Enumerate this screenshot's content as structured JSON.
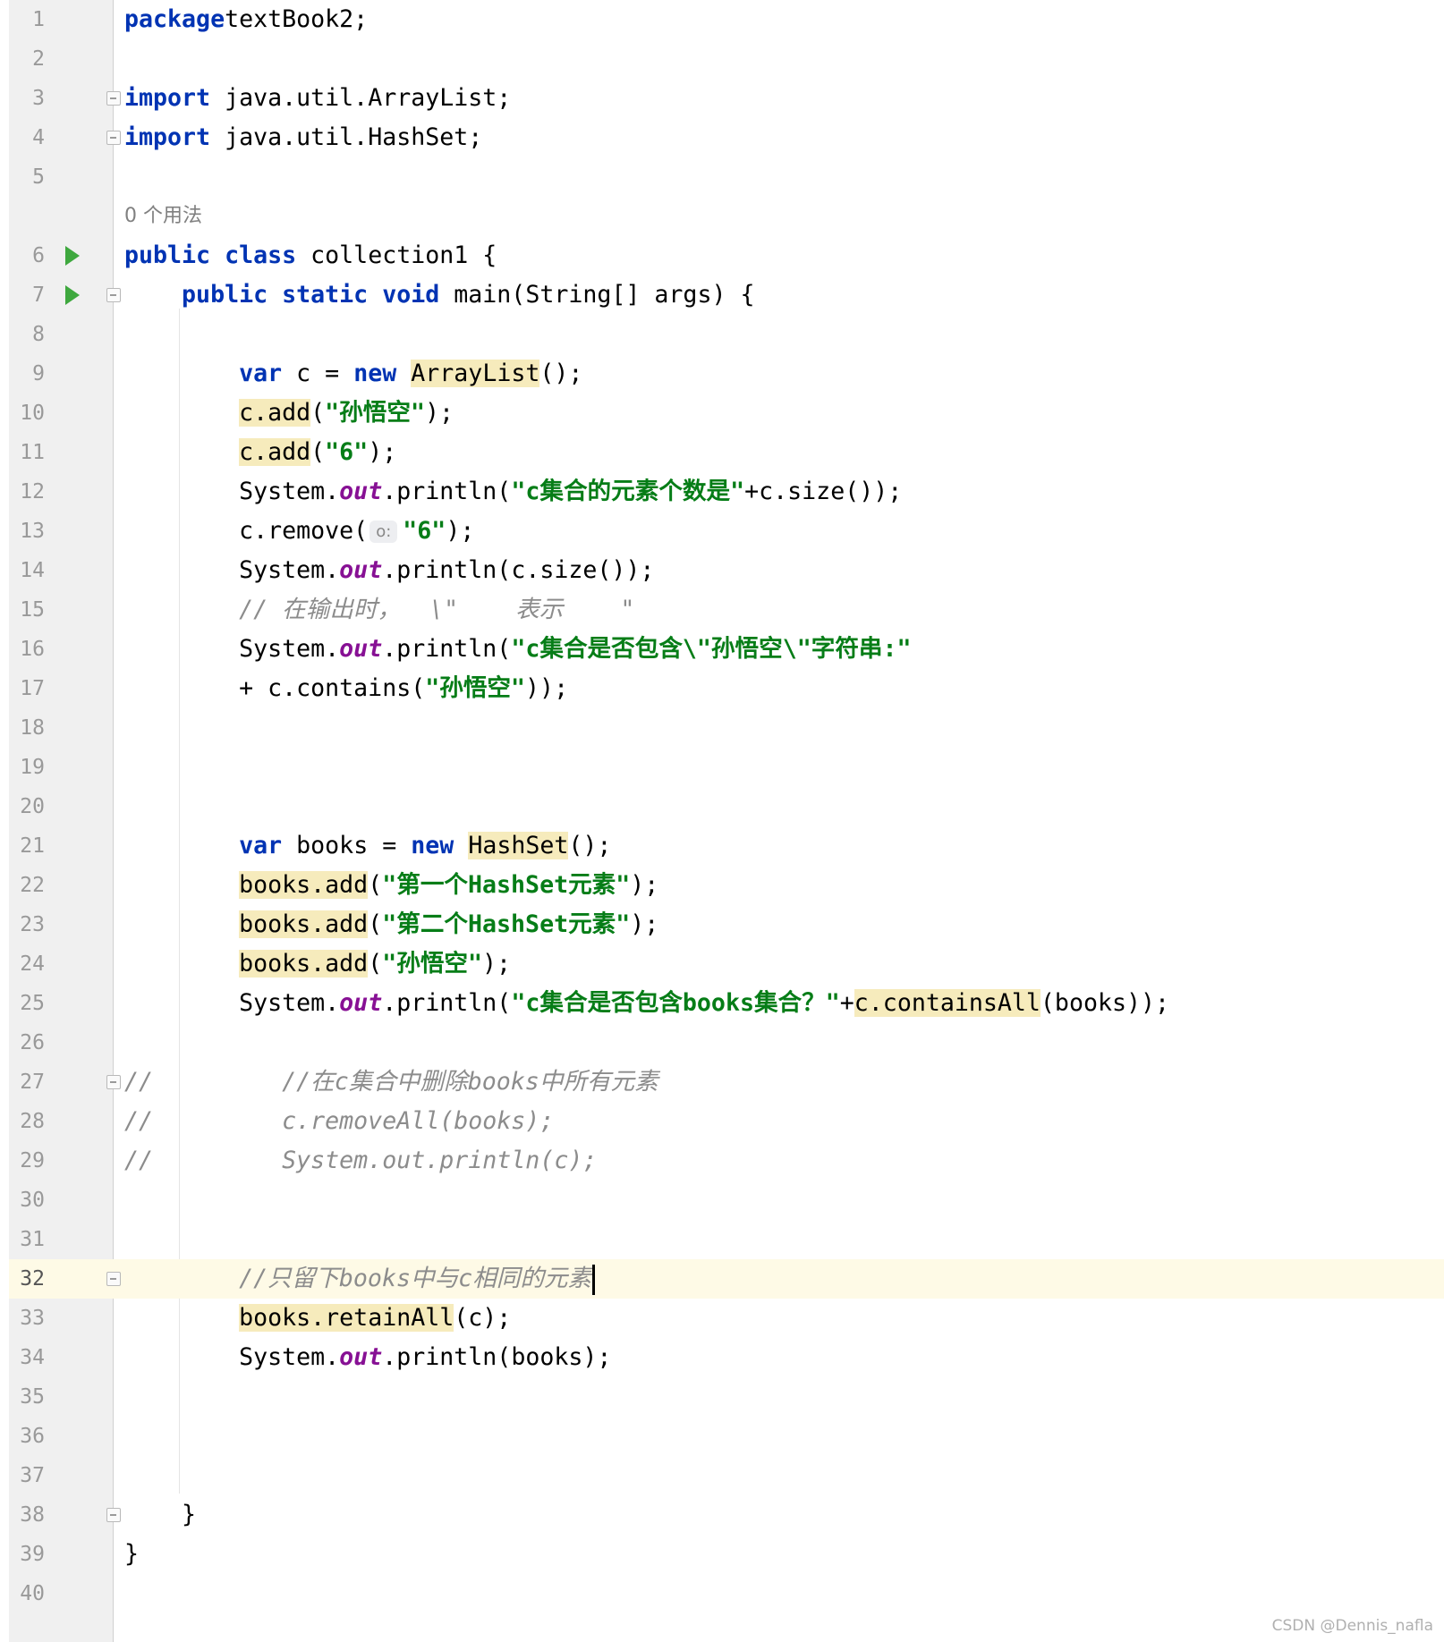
{
  "editor": {
    "usage_hint": "0 个用法",
    "param_hint": "o:",
    "lines": [
      {
        "n": "1",
        "parts": [
          [
            "kw",
            "package"
          ],
          [
            "",
            "textBook2;"
          ]
        ]
      },
      {
        "n": "2",
        "parts": []
      },
      {
        "n": "3",
        "fold": true,
        "parts": [
          [
            "kw",
            "import"
          ],
          [
            "",
            " java.util.ArrayList;"
          ]
        ]
      },
      {
        "n": "4",
        "fold": true,
        "parts": [
          [
            "kw",
            "import"
          ],
          [
            "",
            " java.util.HashSet;"
          ]
        ]
      },
      {
        "n": "5",
        "parts": []
      },
      {
        "n": "6",
        "run": true,
        "parts": [
          [
            "kw",
            "public class"
          ],
          [
            "",
            " collection1 {"
          ]
        ]
      },
      {
        "n": "7",
        "run": true,
        "fold": true,
        "parts": [
          [
            "",
            "    "
          ],
          [
            "kw",
            "public static void"
          ],
          [
            "",
            " main(String[] args) {"
          ]
        ]
      },
      {
        "n": "8",
        "parts": []
      },
      {
        "n": "9",
        "parts": [
          [
            "",
            "        "
          ],
          [
            "kw",
            "var"
          ],
          [
            "",
            " c = "
          ],
          [
            "kw",
            "new"
          ],
          [
            "",
            " "
          ],
          [
            "hl",
            "ArrayList"
          ],
          [
            "",
            "();"
          ]
        ]
      },
      {
        "n": "10",
        "parts": [
          [
            "",
            "        "
          ],
          [
            "hl",
            "c.add"
          ],
          [
            "",
            "("
          ],
          [
            "str",
            "\"孙悟空\""
          ],
          [
            "",
            ");"
          ]
        ]
      },
      {
        "n": "11",
        "parts": [
          [
            "",
            "        "
          ],
          [
            "hl",
            "c.add"
          ],
          [
            "",
            "("
          ],
          [
            "str",
            "\"6\""
          ],
          [
            "",
            ");"
          ]
        ]
      },
      {
        "n": "12",
        "parts": [
          [
            "",
            "        System."
          ],
          [
            "fld",
            "out"
          ],
          [
            "",
            ".println("
          ],
          [
            "str",
            "\"c集合的元素个数是\""
          ],
          [
            "",
            "+c.size());"
          ]
        ]
      },
      {
        "n": "13",
        "parts": [
          [
            "",
            "        c.remove("
          ],
          [
            "hint",
            "o:"
          ],
          [
            "str",
            "\"6\""
          ],
          [
            "",
            ");"
          ]
        ]
      },
      {
        "n": "14",
        "parts": [
          [
            "",
            "        System."
          ],
          [
            "fld",
            "out"
          ],
          [
            "",
            ".println(c.size());"
          ]
        ]
      },
      {
        "n": "15",
        "parts": [
          [
            "",
            "        "
          ],
          [
            "cmt",
            "// 在输出时，  \\\"    表示    \""
          ]
        ]
      },
      {
        "n": "16",
        "parts": [
          [
            "",
            "        System."
          ],
          [
            "fld",
            "out"
          ],
          [
            "",
            ".println("
          ],
          [
            "str",
            "\"c集合是否包含\\\"孙悟空\\\"字符串:\""
          ]
        ]
      },
      {
        "n": "17",
        "parts": [
          [
            "",
            "        + c.contains("
          ],
          [
            "str",
            "\"孙悟空\""
          ],
          [
            "",
            "));"
          ]
        ]
      },
      {
        "n": "18",
        "parts": []
      },
      {
        "n": "19",
        "parts": []
      },
      {
        "n": "20",
        "parts": []
      },
      {
        "n": "21",
        "parts": [
          [
            "",
            "        "
          ],
          [
            "kw",
            "var"
          ],
          [
            "",
            " books = "
          ],
          [
            "kw",
            "new"
          ],
          [
            "",
            " "
          ],
          [
            "hl",
            "HashSet"
          ],
          [
            "",
            "();"
          ]
        ]
      },
      {
        "n": "22",
        "parts": [
          [
            "",
            "        "
          ],
          [
            "hl",
            "books.add"
          ],
          [
            "",
            "("
          ],
          [
            "str",
            "\"第一个HashSet元素\""
          ],
          [
            "",
            ");"
          ]
        ]
      },
      {
        "n": "23",
        "parts": [
          [
            "",
            "        "
          ],
          [
            "hl",
            "books.add"
          ],
          [
            "",
            "("
          ],
          [
            "str",
            "\"第二个HashSet元素\""
          ],
          [
            "",
            ");"
          ]
        ]
      },
      {
        "n": "24",
        "parts": [
          [
            "",
            "        "
          ],
          [
            "hl",
            "books.add"
          ],
          [
            "",
            "("
          ],
          [
            "str",
            "\"孙悟空\""
          ],
          [
            "",
            ");"
          ]
        ]
      },
      {
        "n": "25",
        "parts": [
          [
            "",
            "        System."
          ],
          [
            "fld",
            "out"
          ],
          [
            "",
            ".println("
          ],
          [
            "str",
            "\"c集合是否包含books集合？\""
          ],
          [
            "",
            "+"
          ],
          [
            "hl",
            "c.containsAll"
          ],
          [
            "",
            "(books));"
          ]
        ]
      },
      {
        "n": "26",
        "parts": []
      },
      {
        "n": "27",
        "fold": true,
        "parts": [
          [
            "cmt",
            "//         //在c集合中删除books中所有元素"
          ]
        ]
      },
      {
        "n": "28",
        "parts": [
          [
            "cmt",
            "//         c.removeAll(books);"
          ]
        ]
      },
      {
        "n": "29",
        "parts": [
          [
            "cmt",
            "//         System.out.println(c);"
          ]
        ]
      },
      {
        "n": "30",
        "parts": []
      },
      {
        "n": "31",
        "parts": []
      },
      {
        "n": "32",
        "current": true,
        "fold": true,
        "parts": [
          [
            "",
            "        "
          ],
          [
            "cmt",
            "//只留下books中与c相同的元素"
          ],
          [
            "caret",
            ""
          ]
        ]
      },
      {
        "n": "33",
        "parts": [
          [
            "",
            "        "
          ],
          [
            "hl",
            "books.retainAll"
          ],
          [
            "",
            "(c);"
          ]
        ]
      },
      {
        "n": "34",
        "parts": [
          [
            "",
            "        System."
          ],
          [
            "fld",
            "out"
          ],
          [
            "",
            ".println(books);"
          ]
        ]
      },
      {
        "n": "35",
        "parts": []
      },
      {
        "n": "36",
        "parts": []
      },
      {
        "n": "37",
        "parts": []
      },
      {
        "n": "38",
        "fold": true,
        "parts": [
          [
            "",
            "    }"
          ]
        ]
      },
      {
        "n": "39",
        "parts": [
          [
            "",
            "}"
          ]
        ]
      },
      {
        "n": "40",
        "parts": []
      }
    ]
  },
  "watermark": "CSDN @Dennis_nafla"
}
